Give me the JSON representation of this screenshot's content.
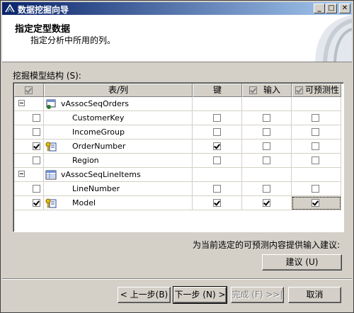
{
  "window": {
    "title": "数据挖掘向导"
  },
  "header": {
    "title": "指定定型数据",
    "subtitle": "指定分析中所用的列。"
  },
  "structure_label": "挖掘模型结构 (S):",
  "grid": {
    "columns": {
      "table": "表/列",
      "key": "键",
      "input": "输入",
      "predict": "可预测性"
    },
    "rows": [
      {
        "type": "table",
        "name": "vAssocSeqOrders"
      },
      {
        "type": "column",
        "name": "CustomerKey",
        "include": false,
        "key_icon": false,
        "key": false,
        "input": false,
        "predict": false
      },
      {
        "type": "column",
        "name": "IncomeGroup",
        "include": false,
        "key_icon": false,
        "key": false,
        "input": false,
        "predict": false
      },
      {
        "type": "column",
        "name": "OrderNumber",
        "include": true,
        "key_icon": true,
        "key": true,
        "input": false,
        "predict": false
      },
      {
        "type": "column",
        "name": "Region",
        "include": false,
        "key_icon": false,
        "key": false,
        "input": false,
        "predict": false
      },
      {
        "type": "table",
        "name": "vAssocSeqLineItems"
      },
      {
        "type": "column",
        "name": "LineNumber",
        "include": false,
        "key_icon": false,
        "key": false,
        "input": false,
        "predict": false
      },
      {
        "type": "column",
        "name": "Model",
        "include": true,
        "key_icon": true,
        "key": true,
        "input": true,
        "predict": true
      }
    ]
  },
  "suggest_label": "为当前选定的可预测内容提供输入建议:",
  "buttons": {
    "suggest": "建议 (U)",
    "back": "< 上一步(B)",
    "next": "下一步 (N) >",
    "finish": "完成 (F) >>|",
    "cancel": "取消"
  },
  "colors": {
    "title_start": "#0a246a",
    "title_end": "#a6caf0",
    "face": "#d4d0c8"
  }
}
